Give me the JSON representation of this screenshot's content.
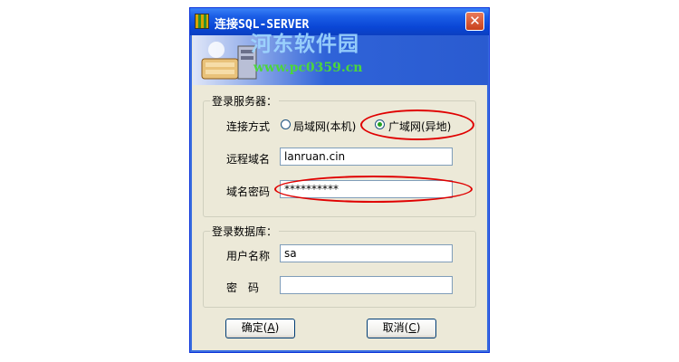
{
  "window": {
    "title": "连接SQL-SERVER",
    "close_icon": "✕",
    "watermark_title": "河东软件园",
    "watermark_url": "www.pc0359.cn"
  },
  "server_group": {
    "legend": "登录服务器：",
    "connection_label": "连接方式",
    "options": [
      {
        "label": "局域网(本机)",
        "selected": false
      },
      {
        "label": "广域网(异地)",
        "selected": true
      }
    ],
    "domain_label": "远程域名",
    "domain_value": "lanruan.cin",
    "password_label": "域名密码",
    "password_value": "**********"
  },
  "db_group": {
    "legend": "登录数据库：",
    "user_label": "用户名称",
    "user_value": "sa",
    "password_label": "密　码",
    "password_value": ""
  },
  "buttons": {
    "ok_label": "确定",
    "ok_hotkey": "A",
    "cancel_label": "取消",
    "cancel_hotkey": "C"
  },
  "annotation_color": "#e00000"
}
